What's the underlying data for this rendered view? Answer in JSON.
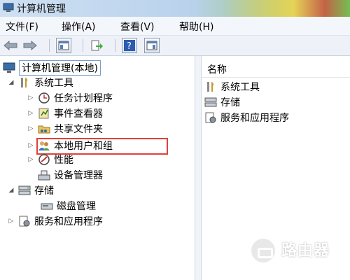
{
  "window": {
    "title": "计算机管理"
  },
  "menu": [
    {
      "label": "文件(F)"
    },
    {
      "label": "操作(A)"
    },
    {
      "label": "查看(V)"
    },
    {
      "label": "帮助(H)"
    }
  ],
  "toolbar": {
    "buttons": [
      "back-icon",
      "forward-icon",
      "console-tree-icon",
      "export-list-icon",
      "help-icon",
      "show-hide-action-pane-icon"
    ]
  },
  "tree": {
    "root": "计算机管理(本地)",
    "system_tools": "系统工具",
    "task_scheduler": "任务计划程序",
    "event_viewer": "事件查看器",
    "shared_folders": "共享文件夹",
    "local_users_groups": "本地用户和组",
    "performance": "性能",
    "device_manager": "设备管理器",
    "storage": "存储",
    "disk_management": "磁盘管理",
    "services_apps": "服务和应用程序"
  },
  "right_pane": {
    "column_header": "名称",
    "items": [
      "系统工具",
      "存储",
      "服务和应用程序"
    ]
  },
  "highlight_color": "#e0413a",
  "watermark": {
    "text": "路由器"
  }
}
